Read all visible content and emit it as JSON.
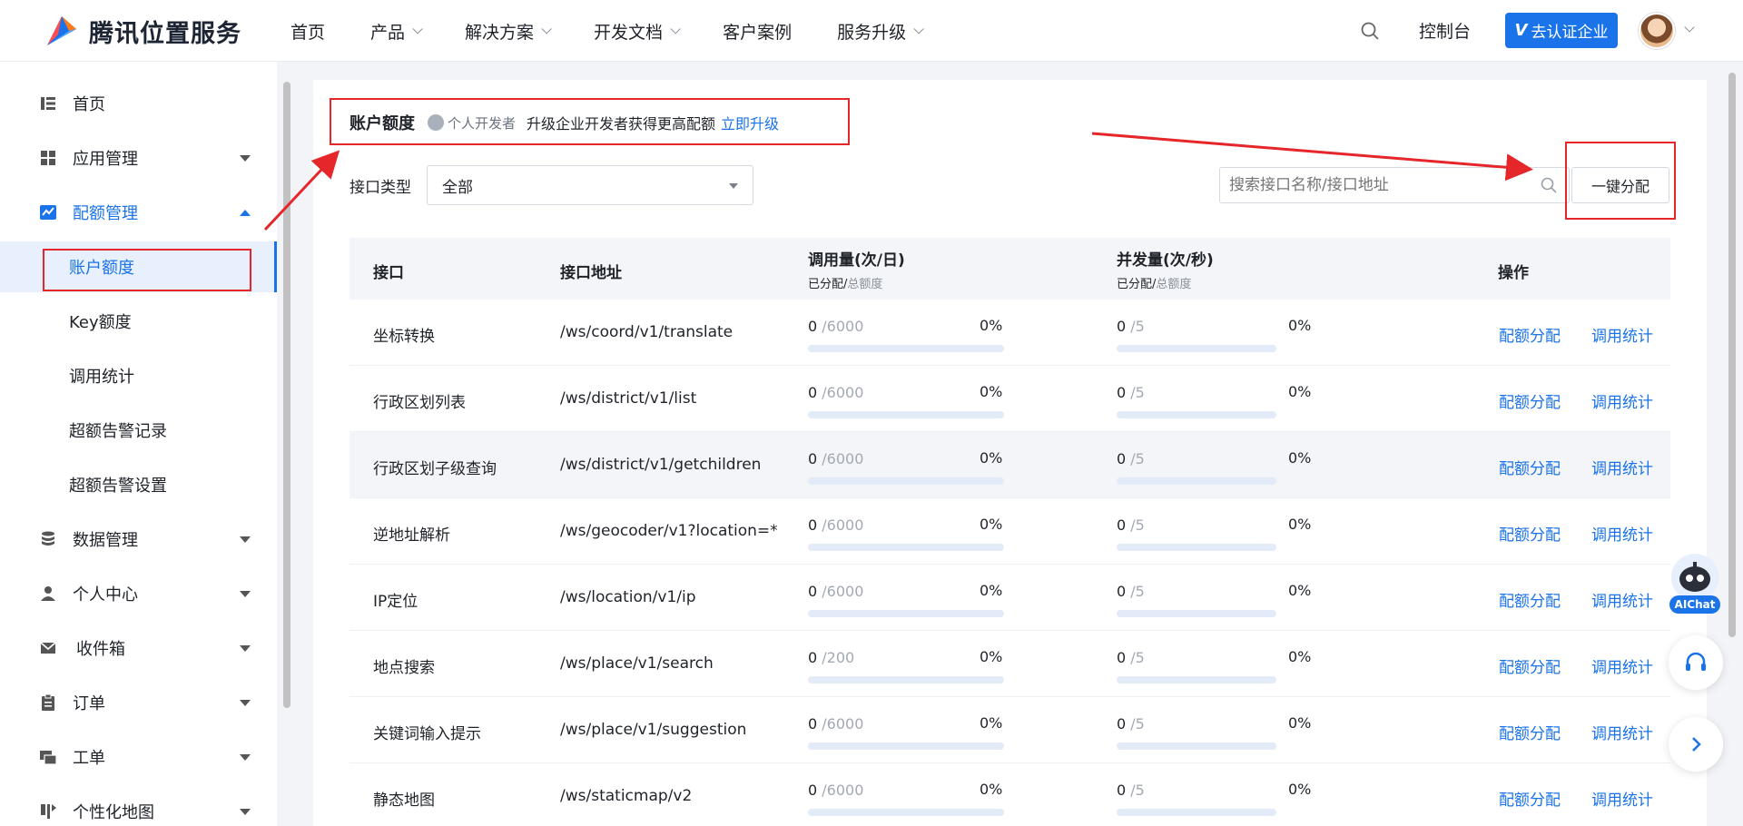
{
  "brand": {
    "name": "腾讯位置服务"
  },
  "nav": [
    "首页",
    "产品",
    "解决方案",
    "开发文档",
    "客户案例",
    "服务升级"
  ],
  "header": {
    "console": "控制台",
    "certify": "去认证企业",
    "certify_v": "V"
  },
  "sidebar": {
    "items": [
      "首页",
      "应用管理",
      "配额管理",
      "数据管理",
      "个人中心",
      "收件箱",
      "订单",
      "工单",
      "个性化地图"
    ],
    "sub_items": [
      "账户额度",
      "Key额度",
      "调用统计",
      "超额告警记录",
      "超额告警设置"
    ]
  },
  "page": {
    "title": "账户额度",
    "dev_type": "个人开发者",
    "hint": "升级企业开发者获得更高配额",
    "upgrade_link": "立即升级",
    "filter_label": "接口类型",
    "filter_value": "全部",
    "search_placeholder": "搜索接口名称/接口地址",
    "alloc_button": "一键分配"
  },
  "table": {
    "headers": {
      "api": "接口",
      "address": "接口地址",
      "calls": "调用量(次/日)",
      "calls_sub_a": "已分配/",
      "calls_sub_b": "总额度",
      "conc": "并发量(次/秒)",
      "conc_sub_a": "已分配/",
      "conc_sub_b": "总额度",
      "ops": "操作"
    },
    "rows": [
      {
        "name": "坐标转换",
        "addr": "/ws/coord/v1/translate",
        "calls_used": "0",
        "calls_total": "/6000",
        "calls_pct": "0%",
        "calls_frac": 0,
        "conc_used": "0",
        "conc_total": "/5",
        "conc_pct": "0%",
        "conc_frac": 0
      },
      {
        "name": "行政区划列表",
        "addr": "/ws/district/v1/list",
        "calls_used": "0",
        "calls_total": "/6000",
        "calls_pct": "0%",
        "calls_frac": 0,
        "conc_used": "0",
        "conc_total": "/5",
        "conc_pct": "0%",
        "conc_frac": 0
      },
      {
        "name": "行政区划子级查询",
        "addr": "/ws/district/v1/getchildren",
        "calls_used": "0",
        "calls_total": "/6000",
        "calls_pct": "0%",
        "calls_frac": 0,
        "conc_used": "0",
        "conc_total": "/5",
        "conc_pct": "0%",
        "conc_frac": 0
      },
      {
        "name": "逆地址解析",
        "addr": "/ws/geocoder/v1?location=*",
        "calls_used": "0",
        "calls_total": "/6000",
        "calls_pct": "0%",
        "calls_frac": 0,
        "conc_used": "0",
        "conc_total": "/5",
        "conc_pct": "0%",
        "conc_frac": 0
      },
      {
        "name": "IP定位",
        "addr": "/ws/location/v1/ip",
        "calls_used": "0",
        "calls_total": "/6000",
        "calls_pct": "0%",
        "calls_frac": 0,
        "conc_used": "0",
        "conc_total": "/5",
        "conc_pct": "0%",
        "conc_frac": 0
      },
      {
        "name": "地点搜索",
        "addr": "/ws/place/v1/search",
        "calls_used": "0",
        "calls_total": "/200",
        "calls_pct": "0%",
        "calls_frac": 0,
        "conc_used": "0",
        "conc_total": "/5",
        "conc_pct": "0%",
        "conc_frac": 0
      },
      {
        "name": "关键词输入提示",
        "addr": "/ws/place/v1/suggestion",
        "calls_used": "0",
        "calls_total": "/6000",
        "calls_pct": "0%",
        "calls_frac": 0,
        "conc_used": "0",
        "conc_total": "/5",
        "conc_pct": "0%",
        "conc_frac": 0
      },
      {
        "name": "静态地图",
        "addr": "/ws/staticmap/v2",
        "calls_used": "0",
        "calls_total": "/6000",
        "calls_pct": "0%",
        "calls_frac": 0,
        "conc_used": "0",
        "conc_total": "/5",
        "conc_pct": "0%",
        "conc_frac": 0
      }
    ],
    "op_alloc": "配额分配",
    "op_stats": "调用统计"
  },
  "widgets": {
    "aichat": "AIChat"
  },
  "colors": {
    "accent": "#1a73e8",
    "annotation": "#e5262b"
  }
}
